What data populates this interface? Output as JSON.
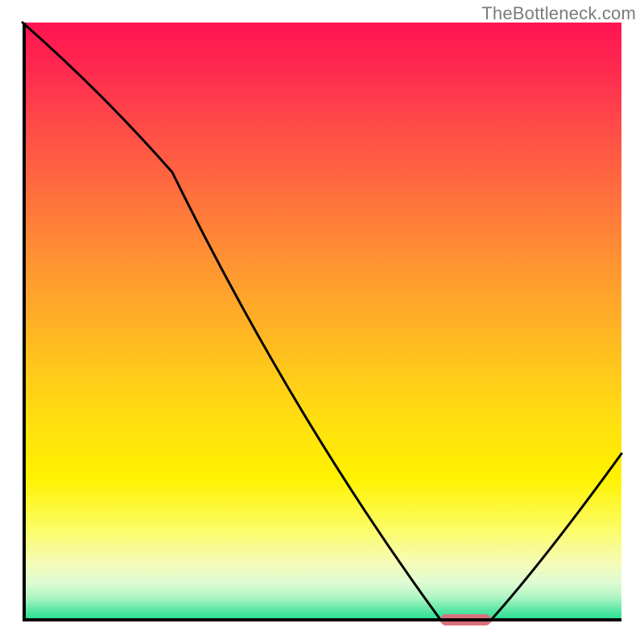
{
  "watermark": "TheBottleneck.com",
  "chart_data": {
    "type": "line",
    "title": "",
    "xlabel": "",
    "ylabel": "",
    "xlim": [
      0,
      100
    ],
    "ylim": [
      0,
      100
    ],
    "grid": false,
    "series": [
      {
        "name": "bottleneck-curve",
        "x": [
          0,
          25,
          70,
          78,
          100
        ],
        "values": [
          100,
          75,
          0,
          0,
          28
        ]
      }
    ],
    "markers": [
      {
        "name": "optimal-region",
        "x_start": 70,
        "x_end": 78,
        "y": 0
      }
    ],
    "background": {
      "type": "vertical-gradient",
      "stops": [
        {
          "offset": 0,
          "color": "#ff1452"
        },
        {
          "offset": 0.37,
          "color": "#ff8a35"
        },
        {
          "offset": 0.76,
          "color": "#fff200"
        },
        {
          "offset": 1.0,
          "color": "#1adf90"
        }
      ]
    }
  }
}
